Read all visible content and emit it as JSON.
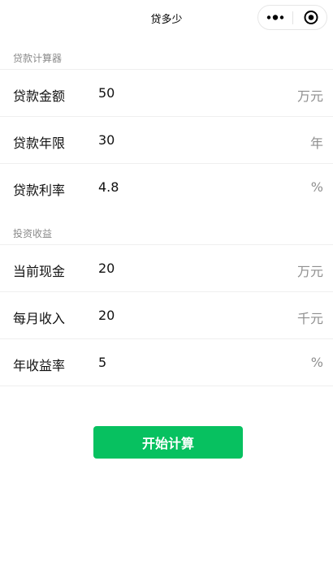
{
  "app": {
    "title": "贷多少"
  },
  "capsule": {
    "more_icon": "more-dots-icon",
    "close_icon": "target-close-icon"
  },
  "colors": {
    "accent": "#07c160",
    "label": "#111111",
    "unit": "#8f8f8f",
    "section": "#8a8a8a",
    "divider": "#efefef"
  },
  "loan": {
    "header": "贷款计算器",
    "rows": [
      {
        "label": "贷款金额",
        "value": "50",
        "unit": "万元"
      },
      {
        "label": "贷款年限",
        "value": "30",
        "unit": "年"
      },
      {
        "label": "贷款利率",
        "value": "4.8",
        "unit": "%"
      }
    ]
  },
  "invest": {
    "header": "投资收益",
    "rows": [
      {
        "label": "当前现金",
        "value": "20",
        "unit": "万元"
      },
      {
        "label": "每月收入",
        "value": "20",
        "unit": "千元"
      },
      {
        "label": "年收益率",
        "value": "5",
        "unit": "%"
      }
    ]
  },
  "actions": {
    "calculate_label": "开始计算"
  }
}
